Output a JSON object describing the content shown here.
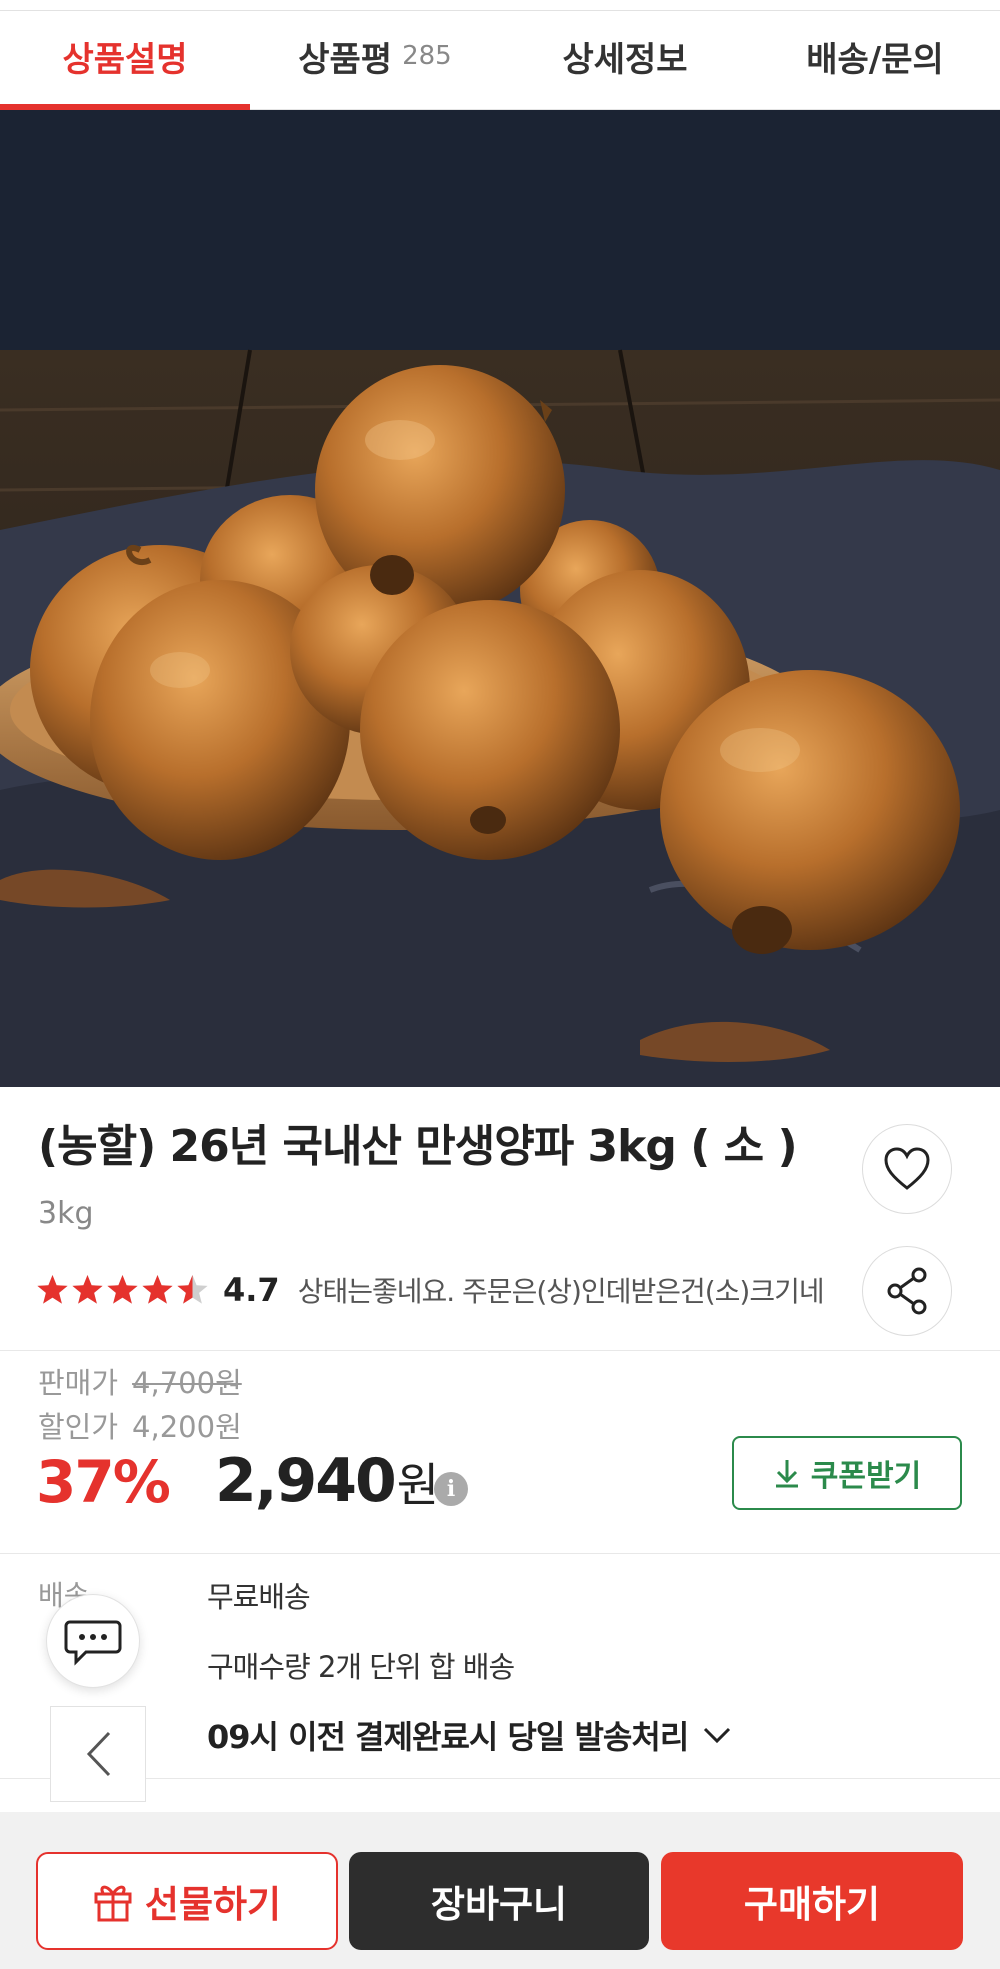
{
  "tabs": [
    {
      "label": "상품설명",
      "active": true
    },
    {
      "label": "상품평",
      "count": "285"
    },
    {
      "label": "상세정보"
    },
    {
      "label": "배송/문의"
    }
  ],
  "product": {
    "title": "(농할) 26년 국내산 만생양파 3kg ( 소 )",
    "weight": "3kg",
    "rating": "4.7",
    "rating_stars": 4.5,
    "review_snippet": "상태는좋네요. 주문은(상)인데받은건(소)크기네"
  },
  "price": {
    "sale_label": "판매가",
    "sale_value": "4,700원",
    "discount_label": "할인가",
    "discount_value": "4,200원",
    "discount_rate": "37%",
    "final_price": "2,940",
    "won": "원",
    "info_icon": "i",
    "coupon_label": "쿠폰받기"
  },
  "shipping": {
    "label": "배송",
    "fee": "무료배송",
    "unit": "구매수량 2개 단위 합 배송",
    "dispatch": "09시 이전 결제완료시 당일 발송처리"
  },
  "bottom_bar": {
    "gift": "선물하기",
    "cart": "장바구니",
    "buy": "구매하기"
  },
  "colors": {
    "accent": "#e5322d",
    "coupon": "#2b8a4b",
    "cart_button": "#2d2d2d",
    "star": "#e5322d"
  },
  "icons": [
    "heart-icon",
    "share-icon",
    "download-icon",
    "chat-icon",
    "chevron-left-icon",
    "chevron-down-icon",
    "gift-icon",
    "info-icon",
    "star-icon"
  ]
}
